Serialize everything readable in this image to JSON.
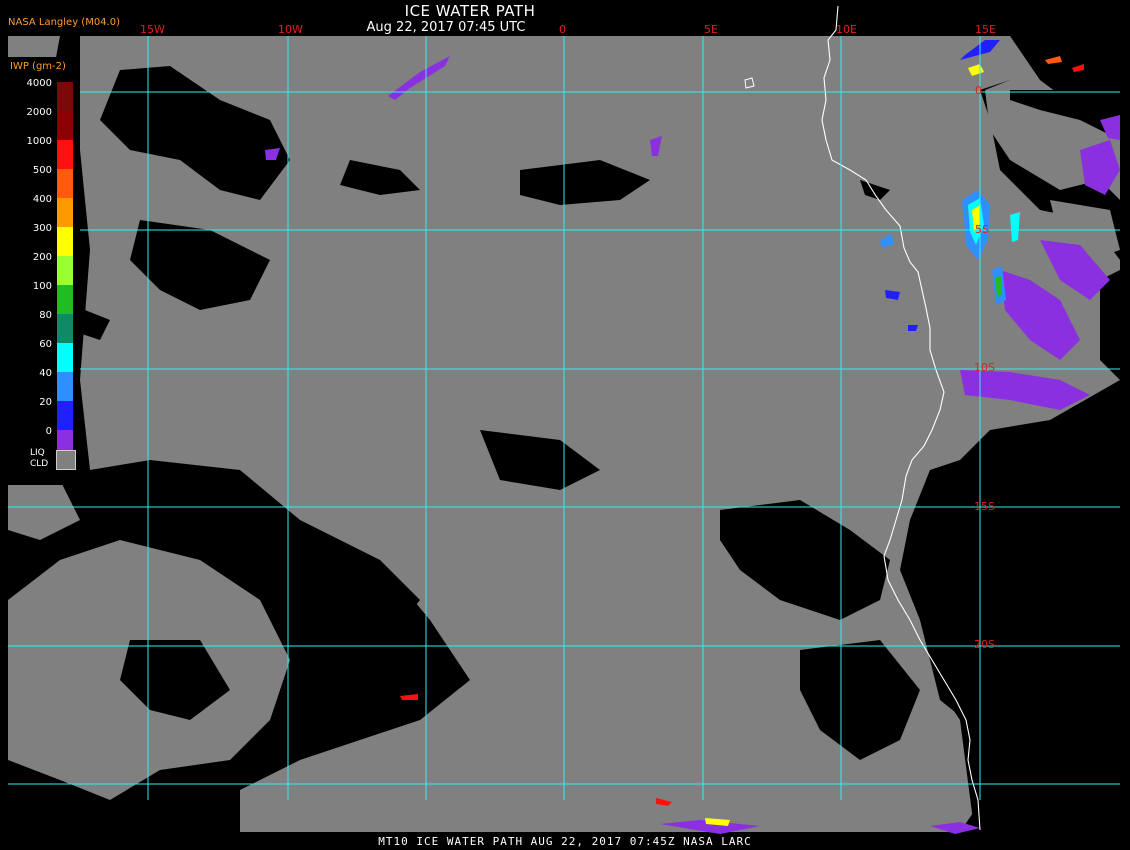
{
  "header": {
    "title": "ICE WATER PATH",
    "subtitle": "Aug 22, 2017 07:45 UTC",
    "agency": "NASA Langley (M04.0)"
  },
  "footer": "MT10  ICE WATER PATH   AUG 22, 2017 07:45Z   NASA LARC",
  "longitude_labels": [
    "15W",
    "10W",
    "0",
    "5E",
    "10E",
    "15E"
  ],
  "latitude_labels": [
    "0",
    "5S",
    "10S",
    "15S",
    "20S"
  ],
  "legend": {
    "title": "IWP (gm-2)",
    "values": [
      "4000",
      "2000",
      "1000",
      "500",
      "400",
      "300",
      "200",
      "100",
      "80",
      "60",
      "40",
      "20",
      "0"
    ],
    "colors": [
      "#7a0a0a",
      "#8b0000",
      "#ff1010",
      "#ff5a10",
      "#ff9900",
      "#ffff00",
      "#99ff33",
      "#22bb22",
      "#118866",
      "#00ffff",
      "#2f8fff",
      "#2020ff",
      "#8a30e0"
    ],
    "liq_label_1": "LIQ",
    "liq_label_2": "CLD",
    "liq_color": "#808080"
  },
  "colors": {
    "background": "#000000",
    "grid": "#2ff0f0",
    "liquid_cloud": "#808080",
    "coastline": "#ffffff",
    "labels": "#e02020"
  }
}
